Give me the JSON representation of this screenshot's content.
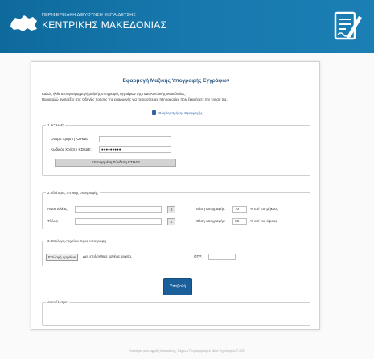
{
  "header": {
    "org_line1": "ΠΕΡΙΦΕΡΕΙΑΚΗ ΔΙΕΥΘΥΝΣΗ ΕΚΠΑΙΔΕΥΣΗΣ",
    "org_line2": "ΚΕΝΤΡΙΚΗΣ ΜΑΚΕΔΟΝΙΑΣ",
    "logo_icon": "region-map-logo",
    "doc_icon": "document-signature-icon",
    "background_color": "#1778ad"
  },
  "panel": {
    "title": "Εφαρμογή Μαζικής Υπογραφής Εγγράφων",
    "intro_line1": "Καλώς ήλθατε στην εφαρμογή μαζικής υπογραφής εγγράφων της ΠΔΕ Κεντρικής Μακεδονίας.",
    "intro_line2": "Παρακαλώ ανατρέξτε στις Οδηγίες Χρήσης της εφαρμογής για περισσότερες πληροφορίες πριν ξεκινήσετε την χρήση της.",
    "guide_link": "Οδηγίες Χρήσης Εφαρμογής",
    "guide_icon": "pdf-document-icon"
  },
  "kshde": {
    "legend": "1. ΚΣΗΔΕ",
    "username_label": "Όνομα Χρήστη ΚΣΗΔΕ:",
    "username_value": "",
    "password_label": "Κωδικός Χρήστη ΚΣΗΔΕ:",
    "password_value": "●●●●●●●●●",
    "verify_button": "Επιτυχημένη Σύνδεση ΚΣΗΔΕ"
  },
  "signature": {
    "legend": "2. Ιδιότητες οπτικής υπογραφής",
    "sender_label": "Αποστολέας:",
    "sender_value": "",
    "title_label": "Τίτλος:",
    "title_value": "",
    "clear_button": "X",
    "pos_label": "Θέση υπογραφής:",
    "width_value": "70",
    "width_suffix": "% επί του μήκους",
    "height_value": "98",
    "height_suffix": "% επί του ύψους"
  },
  "files": {
    "legend": "3. Επιλογή Αρχείων προς υπογραφή",
    "choose_button": "Επιλογή αρχείων",
    "no_file_text": "Δεν επιλέχθηκε κανένα αρχείο.",
    "otp_label": "OTP:",
    "otp_value": ""
  },
  "actions": {
    "submit_button": "Υποβολή",
    "submit_color": "#1a5f9a"
  },
  "result": {
    "legend": "Αποτέλεσμα"
  },
  "footer": {
    "text": "Υλοποίηση από Αφρόδη Αριστοτέλης, Τμήμα Δ' Πληροφορικής & Νέων Τεχνολογιών © 2023"
  }
}
